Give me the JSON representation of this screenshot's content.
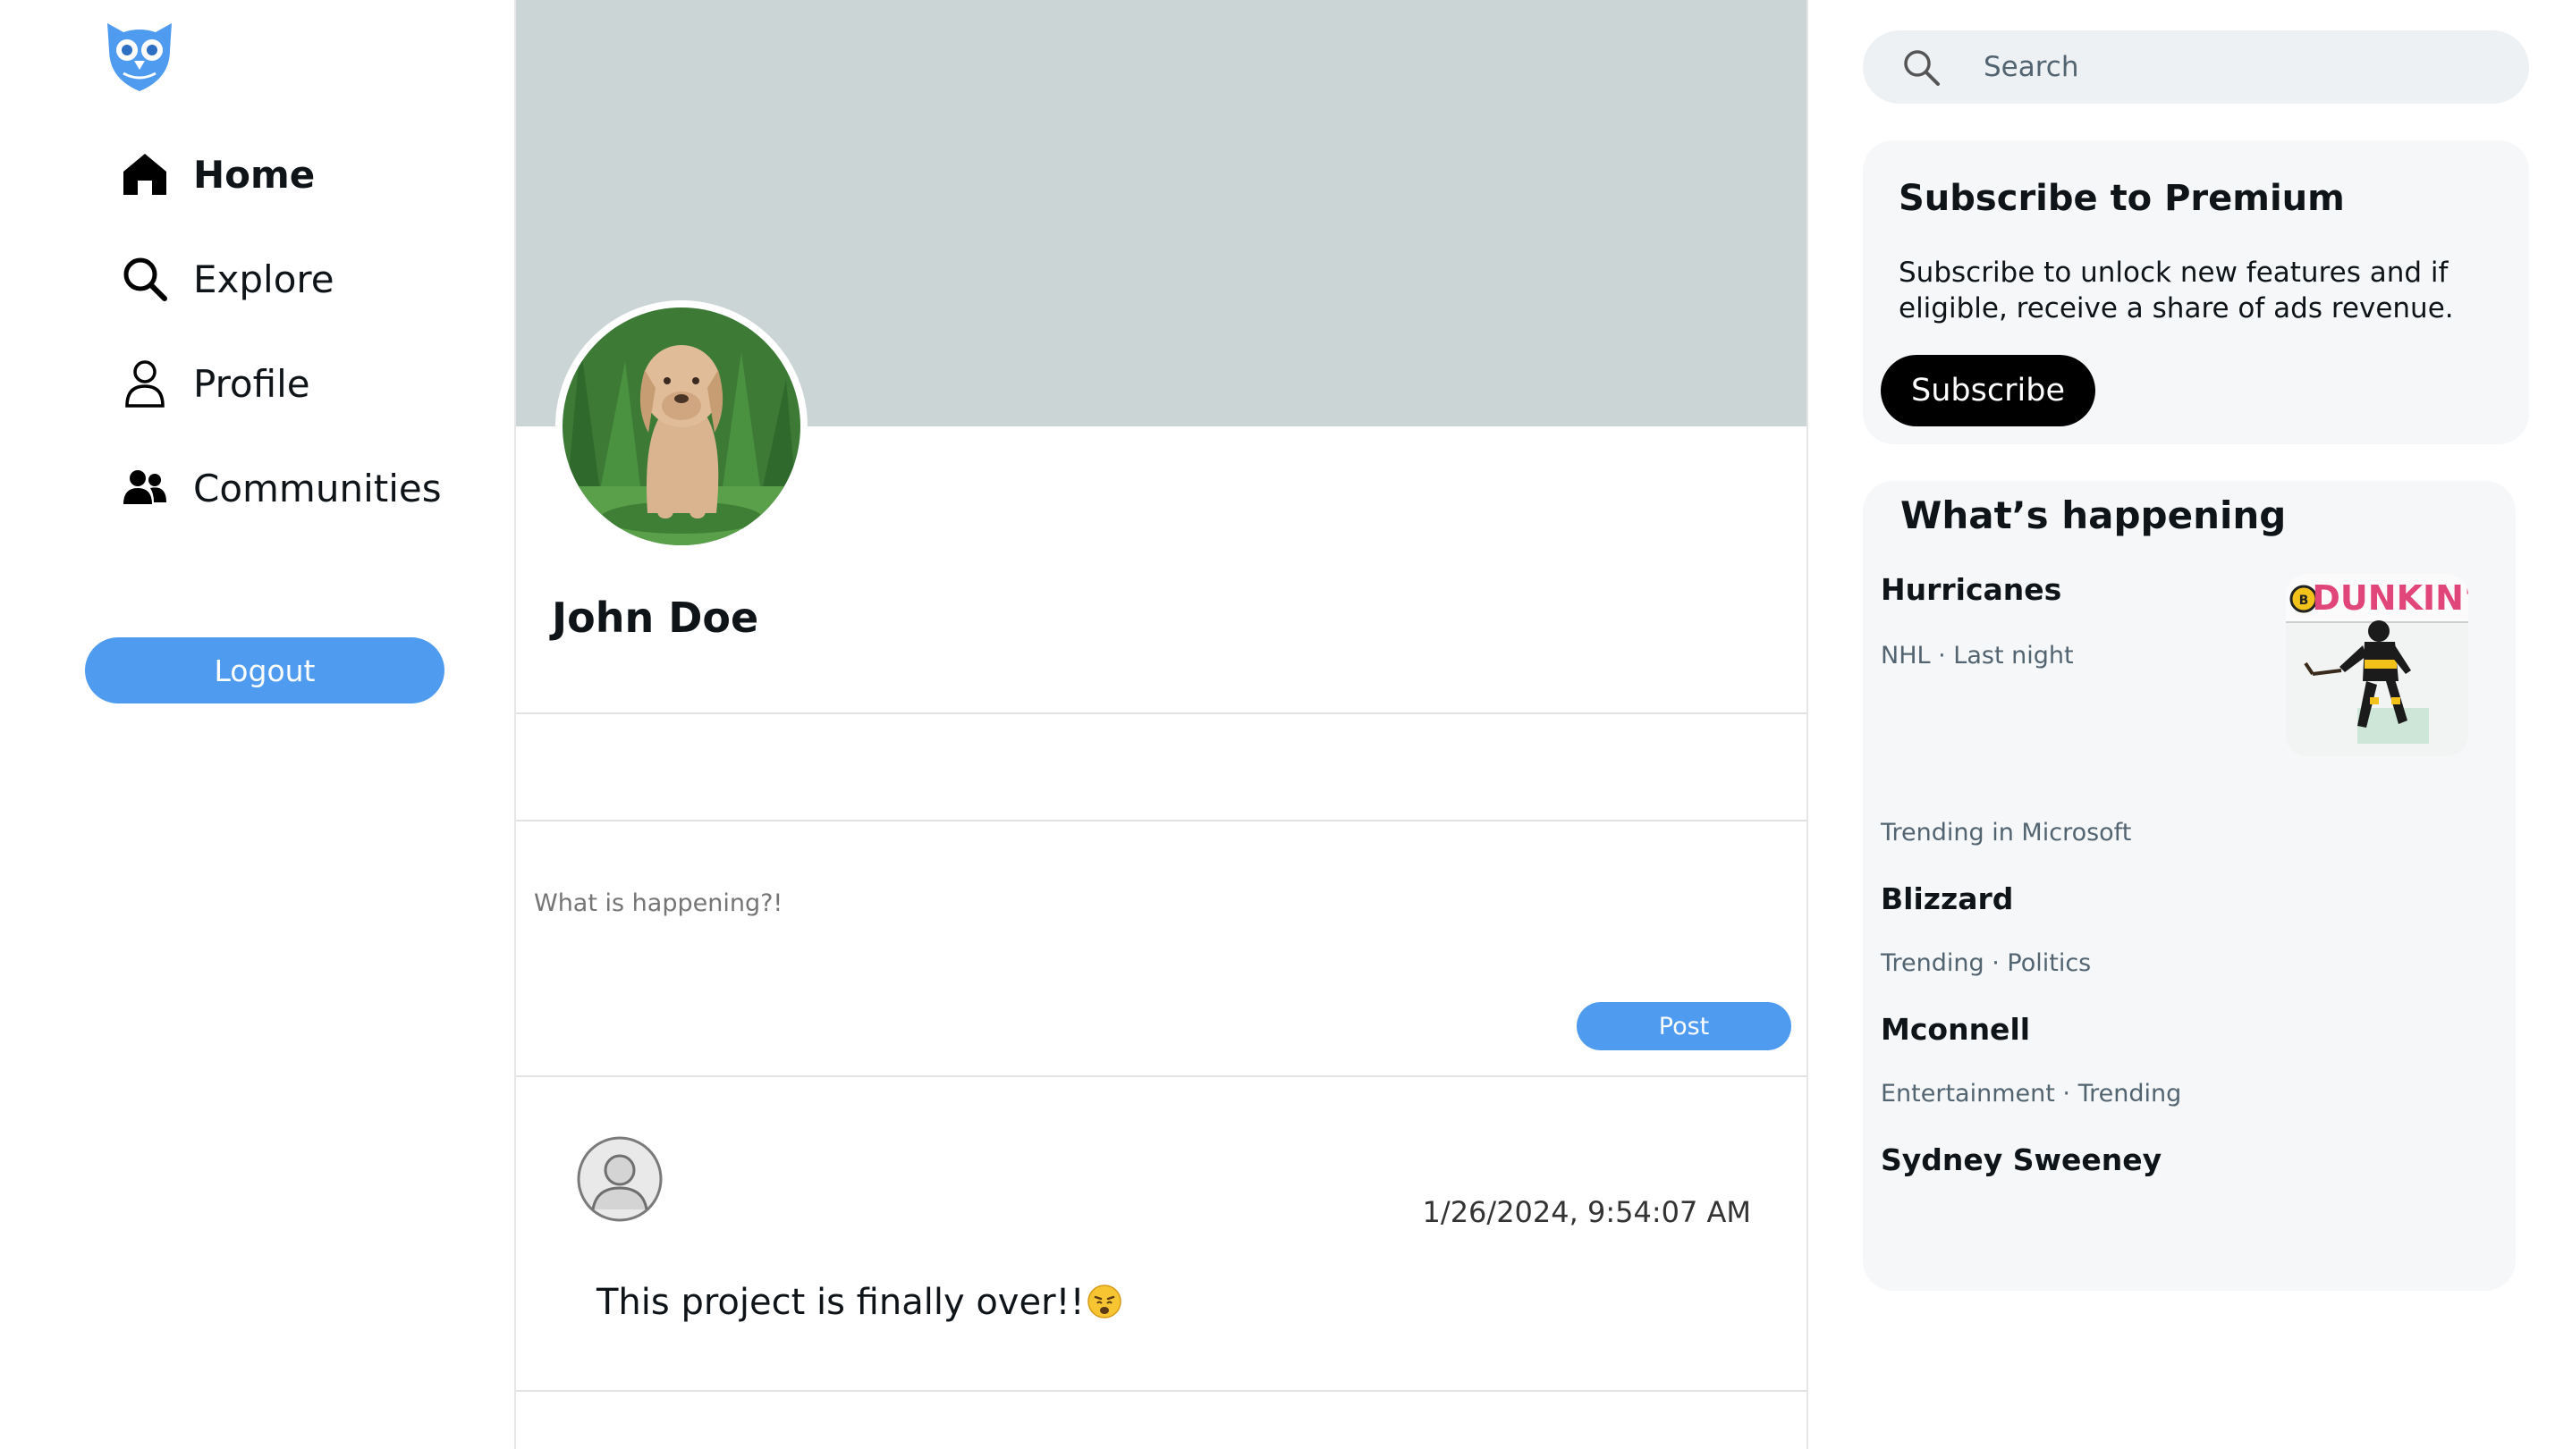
{
  "sidebar": {
    "items": [
      {
        "label": "Home",
        "icon": "home-icon"
      },
      {
        "label": "Explore",
        "icon": "search-icon"
      },
      {
        "label": "Profile",
        "icon": "user-icon"
      },
      {
        "label": "Communities",
        "icon": "people-icon"
      }
    ],
    "logout_label": "Logout"
  },
  "profile": {
    "name": "John Doe"
  },
  "compose": {
    "placeholder": "What is happening?!",
    "post_label": "Post"
  },
  "post": {
    "timestamp": "1/26/2024, 9:54:07 AM",
    "text": "This project is finally over!!"
  },
  "search": {
    "placeholder": "Search"
  },
  "premium": {
    "title": "Subscribe to Premium",
    "description": "Subscribe to unlock new features and if eligible, receive a share of ads revenue.",
    "button_label": "Subscribe"
  },
  "happening": {
    "title": "What’s happening",
    "trends": [
      {
        "title": "Hurricanes",
        "meta": "NHL · Last night"
      },
      {
        "meta": "Trending in Microsoft",
        "title": "Blizzard"
      },
      {
        "meta": "Trending · Politics",
        "title": "Mconnell"
      },
      {
        "meta": "Entertainment · Trending",
        "title": "Sydney Sweeney"
      }
    ],
    "image_text": "DUNKIN'"
  },
  "colors": {
    "accent": "#4f9bf0",
    "banner": "#ccd5d6",
    "panel": "#f5f7f9"
  }
}
